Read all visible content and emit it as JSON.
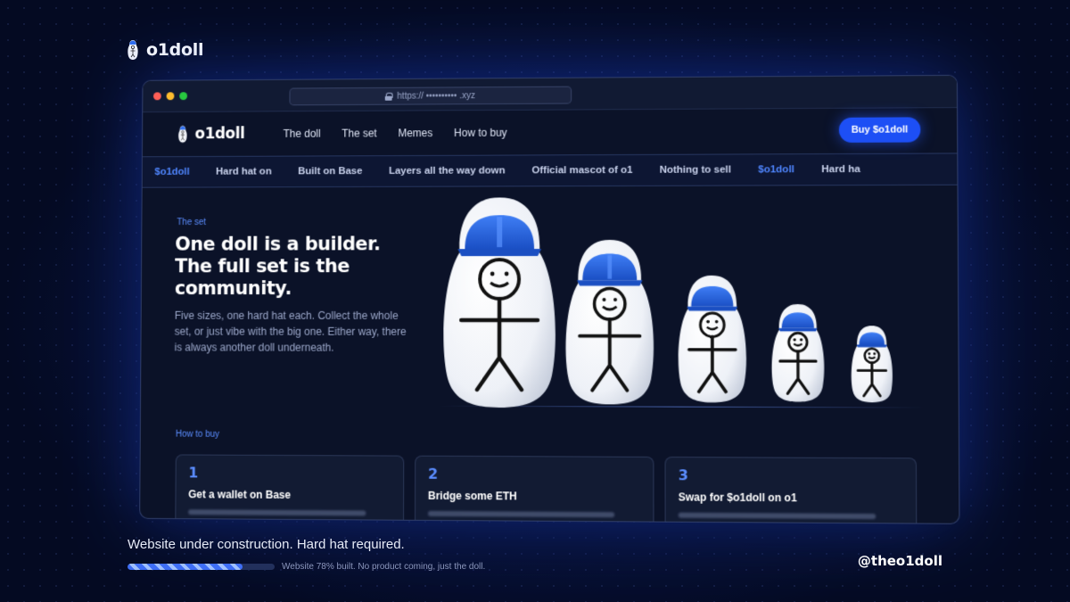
{
  "brand": {
    "name": "o1doll"
  },
  "browser": {
    "url": "https:// •••••••••• .xyz"
  },
  "nav": {
    "logo": "o1doll",
    "links": [
      "The doll",
      "The set",
      "Memes",
      "How to buy"
    ],
    "cta": "Buy $o1doll"
  },
  "ticker": [
    "$o1doll",
    "Hard hat on",
    "Built on Base",
    "Layers all the way down",
    "Official mascot of o1",
    "Nothing to sell",
    "$o1doll",
    "Hard ha"
  ],
  "hero": {
    "eyebrow": "The set",
    "headline": "One doll is a builder. The full set is the community.",
    "sub": "Five sizes, one hard hat each. Collect the whole set, or just vibe with the big one. Either way, there is always another doll underneath."
  },
  "howto": {
    "label": "How to buy",
    "steps": [
      {
        "num": "1",
        "title": "Get a wallet on Base"
      },
      {
        "num": "2",
        "title": "Bridge some ETH"
      },
      {
        "num": "3",
        "title": "Swap for $o1doll on o1"
      }
    ]
  },
  "footer": {
    "tagline": "Website under construction. Hard hat required.",
    "progress_pct": 78,
    "progress_text": "Website 78% built. No product coming, just the doll.",
    "handle": "@theo1doll"
  },
  "colors": {
    "accent": "#1d4ff5",
    "hat": "#1f5fd8",
    "bg": "#060f33"
  }
}
